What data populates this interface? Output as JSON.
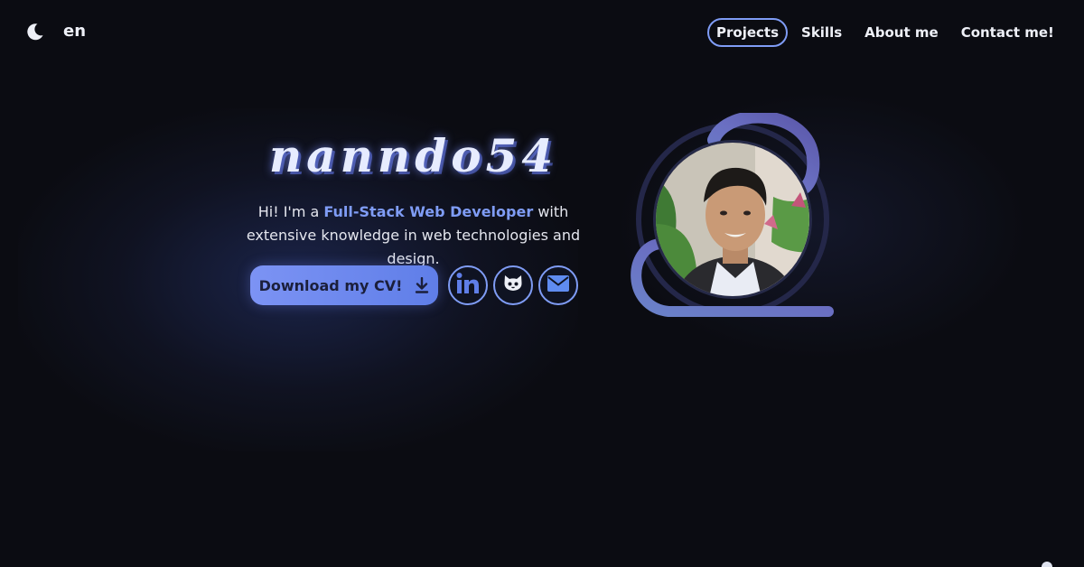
{
  "header": {
    "theme_icon": "moon-icon",
    "language": "en",
    "nav": [
      {
        "label": "Projects",
        "active": true
      },
      {
        "label": "Skills",
        "active": false
      },
      {
        "label": "About me",
        "active": false
      },
      {
        "label": "Contact me!",
        "active": false
      }
    ]
  },
  "hero": {
    "title": "nanndo54",
    "intro_before": "Hi! I'm a ",
    "intro_highlight": "Full-Stack Web Developer",
    "intro_after": " with extensive knowledge in web technologies and design.",
    "cv_button_label": "Download my CV!",
    "socials": [
      {
        "name": "LinkedIn",
        "icon": "linkedin-icon"
      },
      {
        "name": "GitHub",
        "icon": "github-icon"
      },
      {
        "name": "Email",
        "icon": "mail-icon"
      }
    ]
  },
  "colors": {
    "accent": "#7f9cf5",
    "background": "#0b0c12",
    "button_gradient_start": "#7c93f4",
    "button_gradient_end": "#5f7ee8"
  }
}
